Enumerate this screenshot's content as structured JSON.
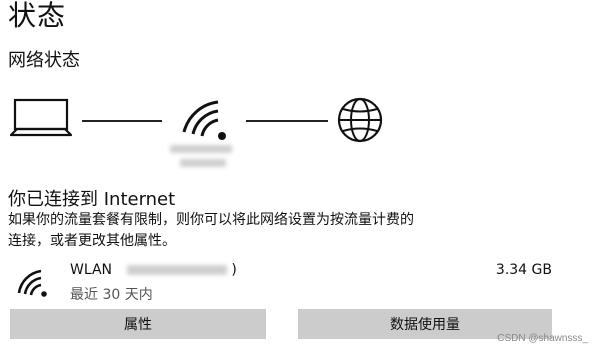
{
  "page": {
    "title": "状态",
    "section_title": "网络状态"
  },
  "diagram": {
    "icons": [
      "laptop-icon",
      "wifi-icon",
      "globe-icon"
    ]
  },
  "connection": {
    "heading": "你已连接到 Internet",
    "description_line1": "如果你的流量套餐有限制，则你可以将此网络设置为按流量计费的",
    "description_line2": "连接，或者更改其他属性。"
  },
  "wlan": {
    "name": "WLAN",
    "name_suffix": ")",
    "period": "最近 30 天内",
    "usage": "3.34 GB"
  },
  "buttons": {
    "properties": "属性",
    "data_usage": "数据使用量"
  },
  "watermark": "CSDN @shawnsss_"
}
